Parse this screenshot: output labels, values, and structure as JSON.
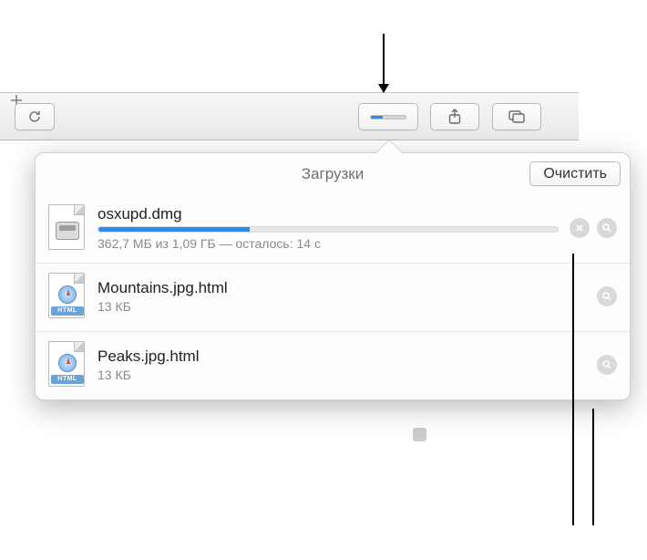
{
  "toolbar": {
    "download_progress_percent": 33
  },
  "popover": {
    "title": "Загрузки",
    "clear_label": "Очистить"
  },
  "downloads": [
    {
      "name": "osxupd.dmg",
      "status": "362,7 МБ из 1,09 ГБ — осталось: 14 с",
      "progress_percent": 33,
      "in_progress": true,
      "kind": "dmg"
    },
    {
      "name": "Mountains.jpg.html",
      "status": "13 КБ",
      "in_progress": false,
      "kind": "html"
    },
    {
      "name": "Peaks.jpg.html",
      "status": "13 КБ",
      "in_progress": false,
      "kind": "html"
    }
  ],
  "icons": {
    "html_badge": "HTML"
  }
}
